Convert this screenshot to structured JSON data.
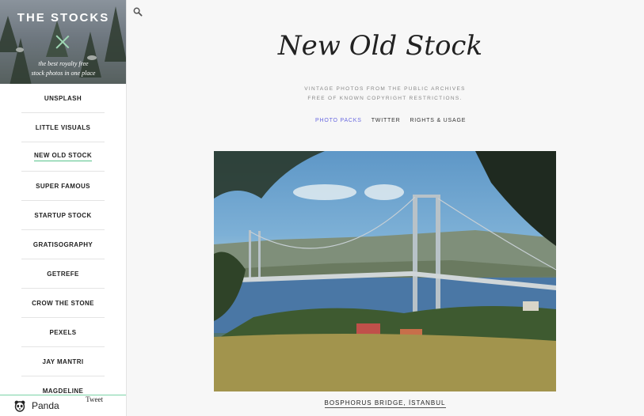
{
  "sidebar": {
    "brand": "THE STOCKS",
    "tagline_line1": "the best royalty free",
    "tagline_line2": "stock photos in one place",
    "items": [
      {
        "label": "UNSPLASH"
      },
      {
        "label": "LITTLE VISUALS"
      },
      {
        "label": "NEW OLD STOCK",
        "active": true
      },
      {
        "label": "SUPER FAMOUS"
      },
      {
        "label": "STARTUP STOCK"
      },
      {
        "label": "GRATISOGRAPHY"
      },
      {
        "label": "GETREFE"
      },
      {
        "label": "CROW THE STONE"
      },
      {
        "label": "PEXELS"
      },
      {
        "label": "JAY MANTRI"
      },
      {
        "label": "MAGDELINE"
      }
    ],
    "footer": {
      "panda_label": "Panda",
      "tweet_label": "Tweet"
    }
  },
  "main": {
    "logo": "New Old Stock",
    "subtitle_line1": "VINTAGE PHOTOS FROM THE PUBLIC ARCHIVES",
    "subtitle_line2": "FREE OF KNOWN COPYRIGHT RESTRICTIONS.",
    "links": [
      "PHOTO PACKS",
      "TWITTER",
      "RIGHTS & USAGE"
    ],
    "photo_caption": "BOSPHORUS BRIDGE, İSTANBUL"
  },
  "icons": [
    "search-icon",
    "panda-icon"
  ],
  "colors": {
    "accent_green": "#58c38b",
    "link_active": "#6a6ae0"
  }
}
